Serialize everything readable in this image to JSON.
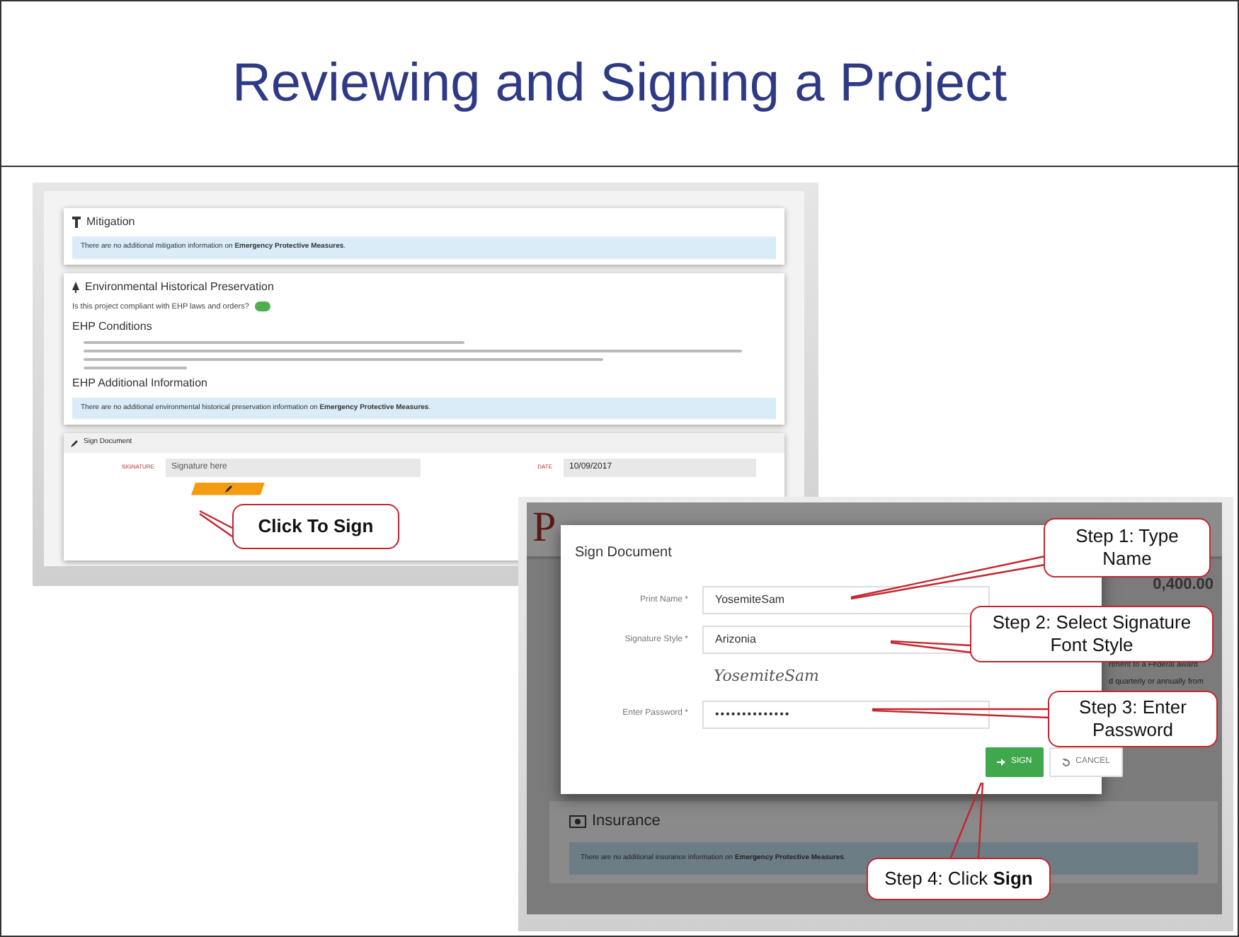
{
  "slide": {
    "title": "Reviewing and Signing a Project"
  },
  "project_page": {
    "mitigation": {
      "heading": "Mitigation",
      "message": "There are no additional mitigation information on **Emergency Protective Measures**."
    },
    "ehp": {
      "heading": "Environmental Historical Preservation",
      "question": "Is this project compliant with EHP laws and orders?",
      "compliant": true,
      "conditions_heading": "EHP Conditions",
      "additional_heading": "EHP Additional Information",
      "message": "There are no additional environmental historical preservation information on **Emergency Protective Measures**."
    },
    "sign_document": {
      "heading": "Sign Document",
      "signature_label": "SIGNATURE",
      "signature_placeholder": "Signature here",
      "date_label": "DATE",
      "date_value": "10/09/2017"
    }
  },
  "sign_dialog": {
    "backdrop": {
      "brand": "P",
      "amount": "0,400.00",
      "snippets": [
        "rtment to a Federal award",
        "d quarterly or annually from"
      ],
      "insurance_heading": "Insurance",
      "insurance_message": "There are no additional insurance information on **Emergency Protective Measures**."
    },
    "title": "Sign Document",
    "fields": [
      {
        "kind": "text",
        "label": "Print Name *",
        "value": "YosemiteSam"
      },
      {
        "kind": "select",
        "label": "Signature Style *",
        "value": "Arizonia"
      },
      {
        "kind": "preview",
        "value": "YosemiteSam"
      },
      {
        "kind": "password",
        "label": "Enter Password *",
        "value": "••••••••••••••"
      }
    ],
    "buttons": [
      {
        "kind": "primary",
        "label": "SIGN"
      },
      {
        "kind": "secondary",
        "label": "CANCEL"
      }
    ]
  },
  "callouts": [
    {
      "text": "Click To Sign"
    },
    {
      "text": "Step 1: Type Name"
    },
    {
      "text": "Step 2: Select Signature Font Style"
    },
    {
      "text": "Step 3: Enter Password"
    },
    {
      "text": "Step 4: Click **Sign**"
    }
  ]
}
